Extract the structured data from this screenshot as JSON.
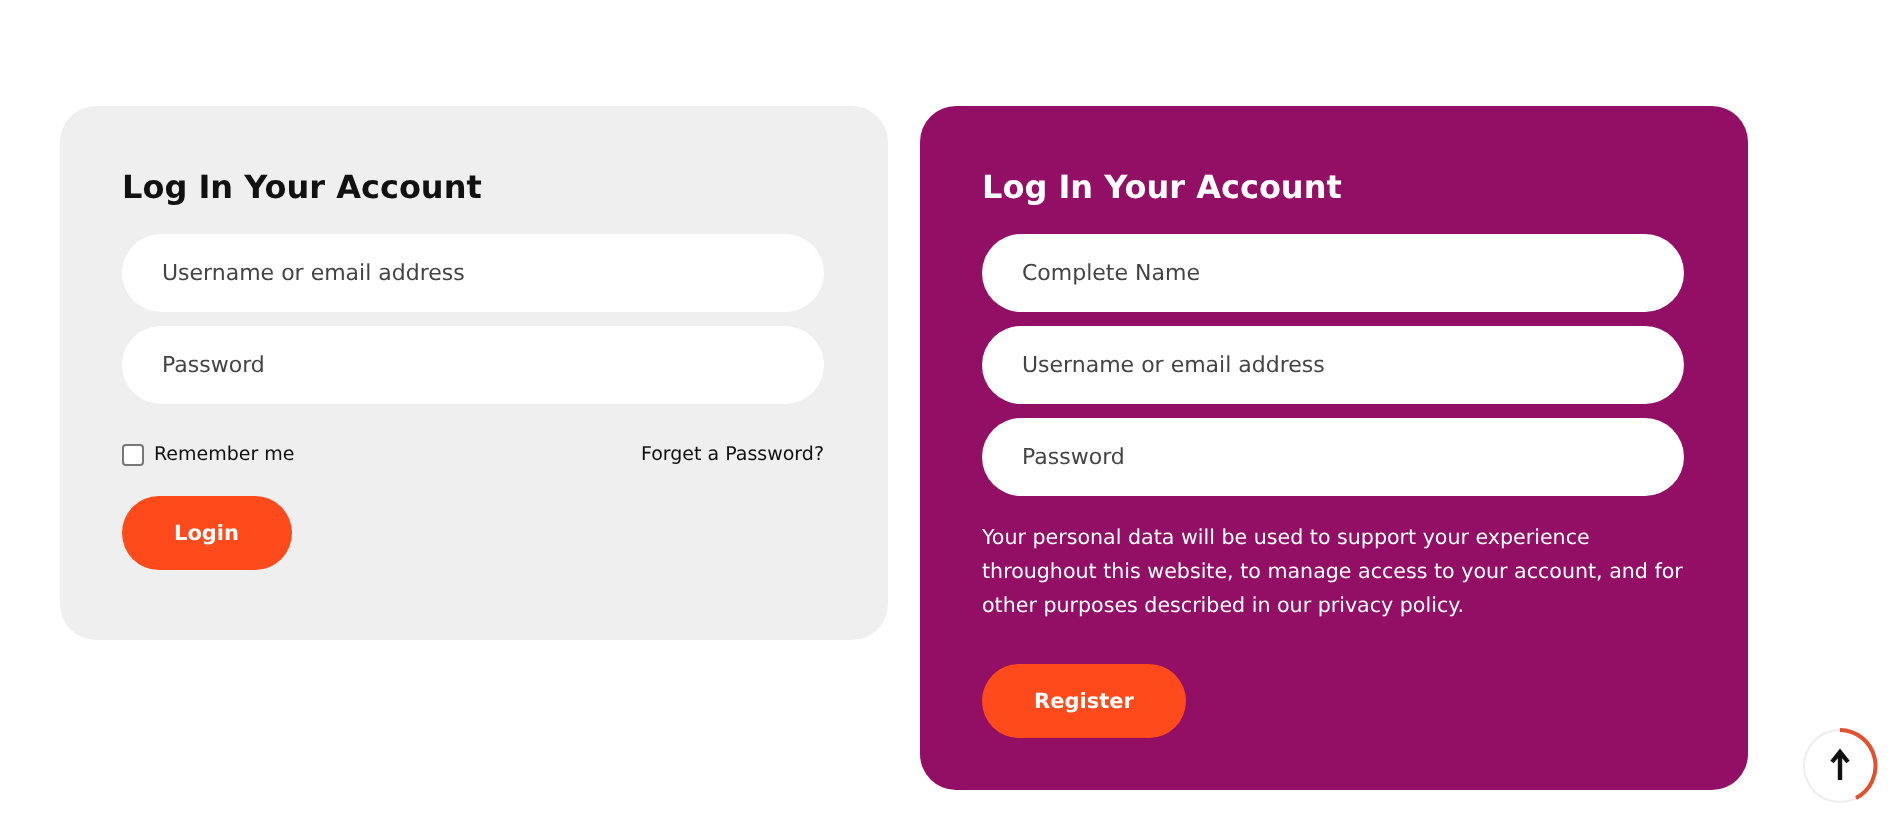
{
  "cards": [
    {
      "kind": "login",
      "title": "Log In Your Account",
      "fields": [
        {
          "placeholder": "Username or email address"
        },
        {
          "placeholder": "Password"
        }
      ],
      "remember": {
        "label": "Remember me",
        "checked": false
      },
      "forgot_link": "Forget a Password?",
      "button": "Login"
    },
    {
      "kind": "register",
      "title": "Log In Your Account",
      "fields": [
        {
          "placeholder": "Complete Name"
        },
        {
          "placeholder": "Username or email address"
        },
        {
          "placeholder": "Password"
        }
      ],
      "note": "Your personal data will be used to support your experience throughout this website, to manage access to your account, and for other purposes described in our privacy policy.",
      "button": "Register"
    }
  ]
}
